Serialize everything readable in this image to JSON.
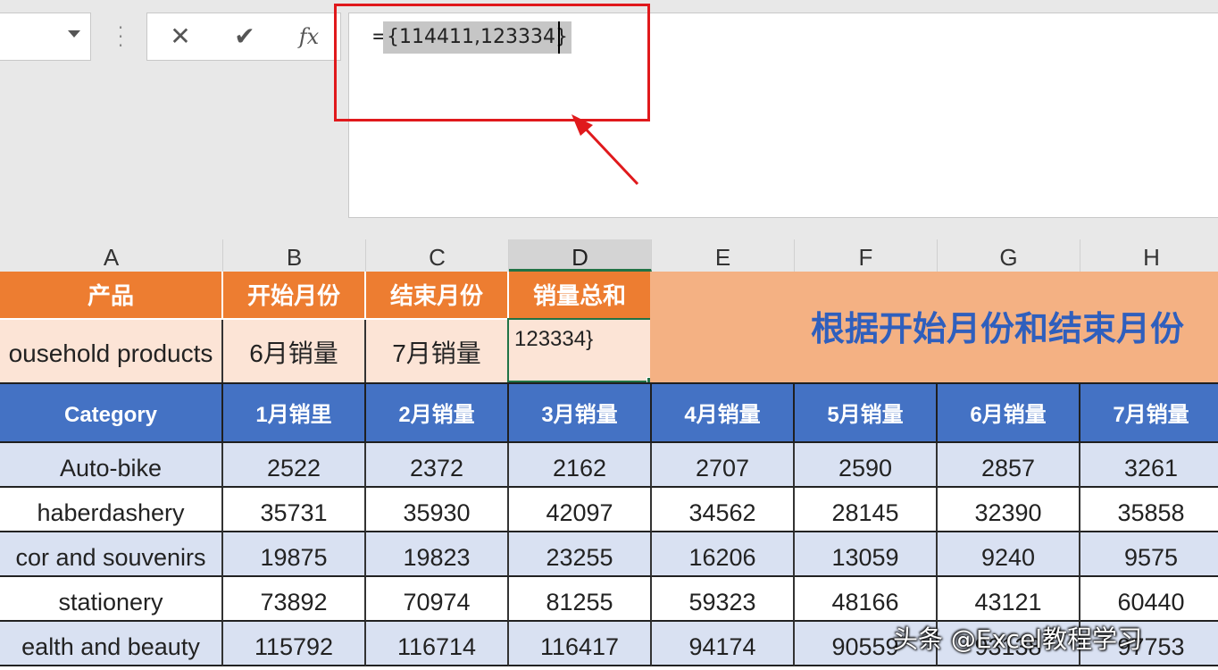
{
  "formula_bar": {
    "name_box_value": "",
    "cancel_icon": "✕",
    "enter_icon": "✔",
    "fx_label": "fx",
    "formula_prefix": "=",
    "formula_selected": "{114411,123334}"
  },
  "columns": [
    "A",
    "B",
    "C",
    "D",
    "E",
    "F",
    "G",
    "H"
  ],
  "selected_column": "D",
  "header_row": [
    "产品",
    "开始月份",
    "结束月份",
    "销量总和"
  ],
  "input_row": [
    "ousehold products",
    "6月销量",
    "7月销量"
  ],
  "active_cell_value": "123334}",
  "merged_title": "根据开始月份和结束月份",
  "table": {
    "headers": [
      "Category",
      "1月销里",
      "2月销量",
      "3月销量",
      "4月销量",
      "5月销量",
      "6月销量",
      "7月销量"
    ],
    "rows": [
      [
        "Auto-bike",
        "2522",
        "2372",
        "2162",
        "2707",
        "2590",
        "2857",
        "3261"
      ],
      [
        " haberdashery",
        "35731",
        "35930",
        "42097",
        "34562",
        "28145",
        "32390",
        "35858"
      ],
      [
        "cor and souvenirs",
        "19875",
        "19823",
        "23255",
        "16206",
        "13059",
        "9240",
        "9575"
      ],
      [
        "stationery",
        "73892",
        "70974",
        "81255",
        "59323",
        "48166",
        "43121",
        "60440"
      ],
      [
        "ealth and beauty",
        "115792",
        "116714",
        "116417",
        "94174",
        "90559",
        "93138",
        "97753"
      ]
    ]
  },
  "watermark": "头条 @Excel教程学习",
  "colors": {
    "orange_header": "#ed7d31",
    "blue_header": "#4472c4",
    "highlight_red": "#e0191c",
    "active_border": "#217346"
  }
}
